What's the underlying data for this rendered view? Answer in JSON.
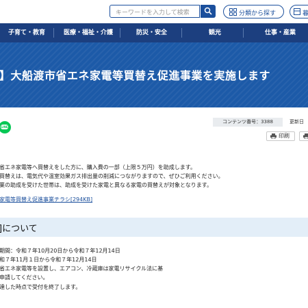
{
  "search": {
    "placeholder": "キーワードを入力して検索",
    "button_icon": "search-icon"
  },
  "header": {
    "category_label": "分類から探す",
    "more_label": "暮"
  },
  "nav": {
    "items": [
      "子育て・教育",
      "医療・福祉・介護",
      "防災・安全",
      "観光",
      "仕事・産業"
    ]
  },
  "hero": {
    "title": "】大船渡市省エネ家電等買替え促進事業を実施します"
  },
  "meta": {
    "content_number": "コンテンツ番号：3388",
    "updated": "更新日",
    "print_label": "印刷",
    "line_icon_text": "LINE"
  },
  "intro": {
    "lines": [
      "省エネ家電等へ買替えをした方に、購入費の一部（上限５万円）を助成します。",
      "買替えは、電気代や温室効果ガス排出量の削減につながりますので、ぜひご利用ください。",
      "業の助成を受けた世帯は、助成を受けた家電と異なる家電の買替えが対象となります。"
    ],
    "pdf_link": "家電等買替え促進事業チラシ[294KB]"
  },
  "section": {
    "title": "]について",
    "lines": [
      "期間：令和７年10月20日から令和７年12月14日",
      "和７年11月１日から令和７年12月14日",
      "省エネ家電等を設置し、エアコン、冷蔵庫は家電リサイクル法に基",
      "申請してください。",
      "達した時点で受付を終了します。"
    ]
  },
  "colors": {
    "nav": "#1c3f7f",
    "hero": "#1c5aa8",
    "accent": "#1b4f9c",
    "section_bg": "#e3eef8"
  }
}
